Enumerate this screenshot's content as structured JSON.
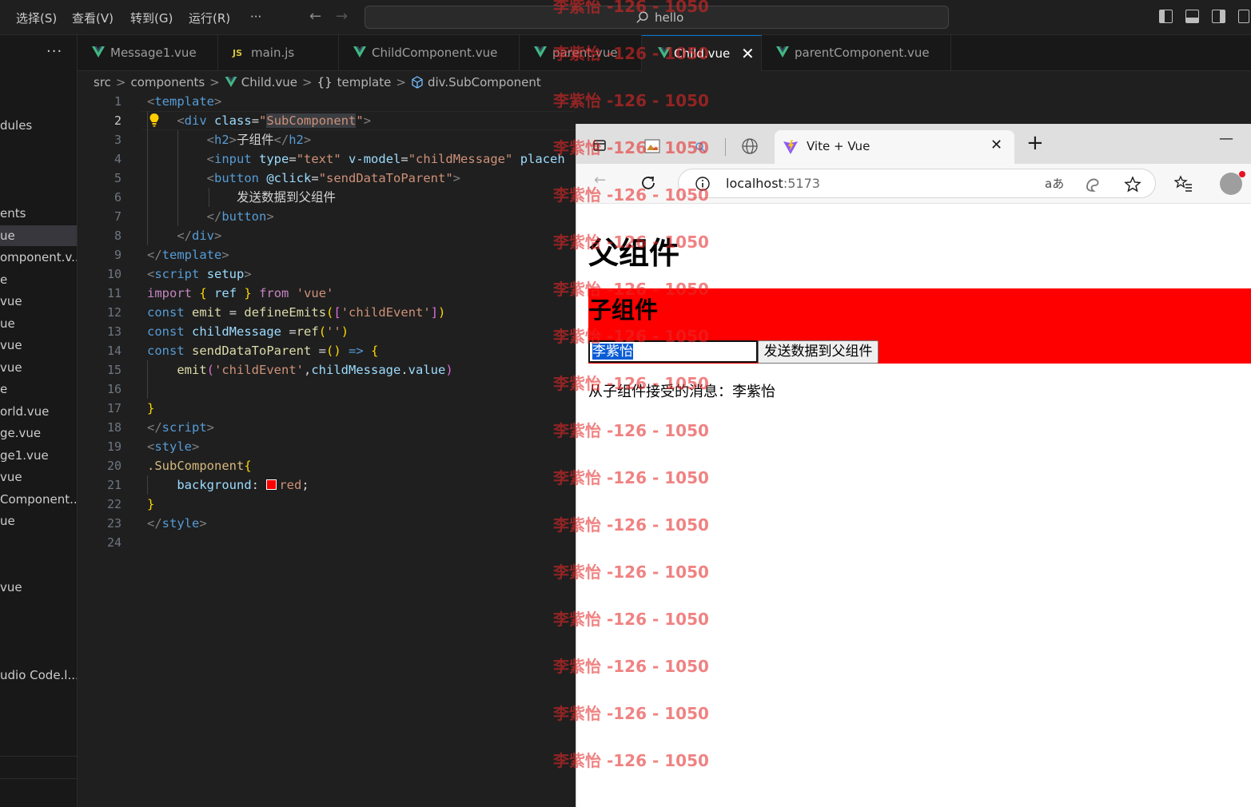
{
  "menu": {
    "items": [
      "选择(S)",
      "查看(V)",
      "转到(G)",
      "运行(R)"
    ],
    "more": "···"
  },
  "command_center": {
    "text": "hello"
  },
  "sidebar": {
    "more": "···",
    "items": [
      "dules",
      "ents",
      "ue",
      "omponent.v...",
      "e",
      "vue",
      "ue",
      "vue",
      "vue",
      "e",
      "orld.vue",
      "ge.vue",
      "ge1.vue",
      "vue",
      "Component....",
      "ue",
      "vue",
      "udio Code.l..."
    ]
  },
  "tabs": [
    {
      "label": "Message1.vue",
      "icon": "vue-icon"
    },
    {
      "label": "main.js",
      "icon": "js-icon",
      "icon_text": "JS"
    },
    {
      "label": "ChildComponent.vue",
      "icon": "vue-icon"
    },
    {
      "label": "parent.vue",
      "icon": "vue-icon"
    },
    {
      "label": "Child.vue",
      "icon": "vue-icon",
      "active": true
    },
    {
      "label": "parentComponent.vue",
      "icon": "vue-icon"
    }
  ],
  "tab_close": "✕",
  "breadcrumb": {
    "items": [
      "src",
      "components",
      "Child.vue",
      "template",
      "div.SubComponent"
    ],
    "code_icon": "{}",
    "sep": ">"
  },
  "editor": {
    "current_line": 2,
    "line_numbers": [
      "1",
      "2",
      "3",
      "4",
      "5",
      "6",
      "7",
      "8",
      "9",
      "10",
      "11",
      "12",
      "13",
      "14",
      "15",
      "16",
      "17",
      "18",
      "19",
      "20",
      "21",
      "22",
      "23",
      "24"
    ]
  },
  "code": {
    "l1": [
      "<",
      "template",
      ">"
    ],
    "l2": [
      "<",
      "div",
      "class",
      "=",
      "\"",
      "SubComponent",
      "\"",
      ">"
    ],
    "l3": [
      "<",
      "h2",
      ">",
      "子组件",
      "</",
      "h2",
      ">"
    ],
    "l4": [
      "<",
      "input",
      "type",
      "=",
      "\"text\"",
      "v-model",
      "=",
      "\"childMessage\"",
      "placeh"
    ],
    "l5": [
      "<",
      "button",
      "@click",
      "=",
      "\"sendDataToParent\"",
      ">"
    ],
    "l6": [
      "发送数据到父组件"
    ],
    "l7": [
      "</",
      "button",
      ">"
    ],
    "l8": [
      "</",
      "div",
      ">"
    ],
    "l9": [
      "</",
      "template",
      ">"
    ],
    "l10": [
      "<",
      "script",
      "setup",
      ">"
    ],
    "l11": [
      "import",
      "{",
      "ref",
      "}",
      "from",
      "'vue'"
    ],
    "l12": [
      "const",
      "emit",
      "=",
      "defineEmits",
      "(",
      "[",
      "'childEvent'",
      "]",
      ")"
    ],
    "l13": [
      "const",
      "childMessage",
      "=",
      "ref",
      "(",
      "''",
      ")"
    ],
    "l14": [
      "const",
      "sendDataToParent",
      "=",
      "(",
      ")",
      "=>",
      "{"
    ],
    "l15": [
      "emit",
      "(",
      "'childEvent'",
      ",",
      "childMessage",
      ".",
      "value",
      ")"
    ],
    "l17": [
      "}"
    ],
    "l18": [
      "</",
      "script",
      ">"
    ],
    "l19": [
      "<",
      "style",
      ">"
    ],
    "l20": [
      ".SubComponent",
      "{"
    ],
    "l21": [
      "background",
      ":",
      "red",
      ";"
    ],
    "l22": [
      "}"
    ],
    "l23": [
      "</",
      "style",
      ">"
    ]
  },
  "browser": {
    "tab_title": "Vite + Vue",
    "tab_close": "✕",
    "new_tab": "+",
    "minimize": "—",
    "address_host": "localhost",
    "address_port": ":5173",
    "translate_label": "aあ"
  },
  "page": {
    "h1": "父组件",
    "h2": "子组件",
    "input_value": "李紫怡",
    "button_label": "发送数据到父组件",
    "message": "从子组件接受的消息：李紫怡"
  },
  "watermark": "李紫怡 -126 - 1050",
  "colors": {
    "editor_bg": "#1f1f1f",
    "sub_component_bg": "#ff0000",
    "accent": "#0078d4",
    "vue_green": "#41b883"
  }
}
